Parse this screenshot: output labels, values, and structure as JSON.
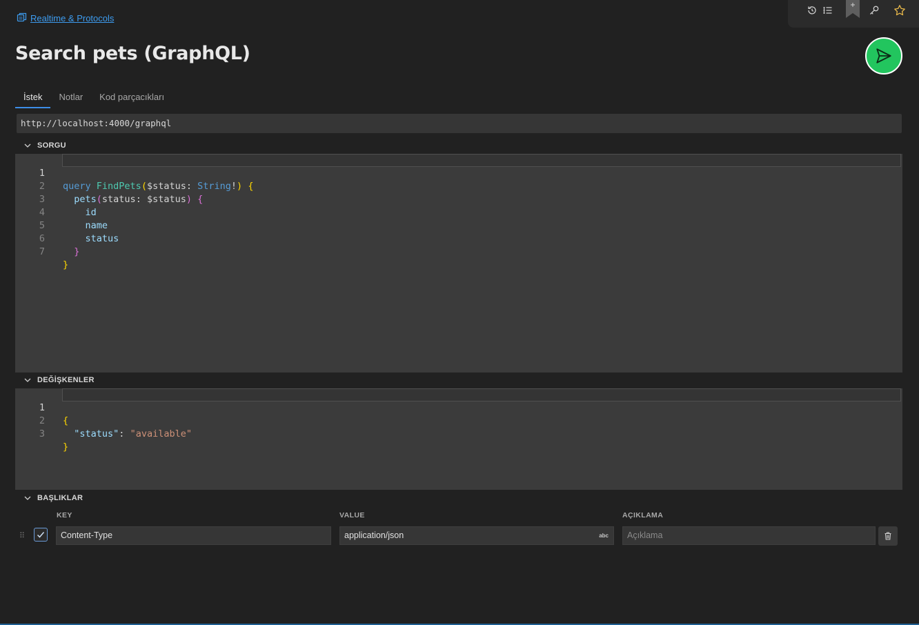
{
  "breadcrumb": {
    "icon": "collection-icon",
    "label": "Realtime & Protocols"
  },
  "toolbar": {
    "icons": [
      "history-icon",
      "list-icon",
      "bookmark-icon",
      "key-icon",
      "star-icon"
    ]
  },
  "title": "Search pets (GraphQL)",
  "send_button": {
    "icon": "send-icon",
    "color": "#22c55e"
  },
  "tabs": [
    {
      "label": "İstek",
      "active": true
    },
    {
      "label": "Notlar",
      "active": false
    },
    {
      "label": "Kod parçacıkları",
      "active": false
    }
  ],
  "url": "http://localhost:4000/graphql",
  "query_section": {
    "title": "SORGU",
    "line_numbers": [
      "1",
      "2",
      "3",
      "4",
      "5",
      "6",
      "7"
    ],
    "lines": [
      "query FindPets($status: String!) {",
      "  pets(status: $status) {",
      "    id",
      "    name",
      "    status",
      "  }",
      "}"
    ]
  },
  "variables_section": {
    "title": "DEĞİŞKENLER",
    "line_numbers": [
      "1",
      "2",
      "3"
    ],
    "lines": [
      "{",
      "  \"status\": \"available\"",
      "}"
    ]
  },
  "headers_section": {
    "title": "BAŞLIKLAR",
    "columns": {
      "key": "KEY",
      "value": "VALUE",
      "description": "AÇIKLAMA"
    },
    "rows": [
      {
        "checked": true,
        "key": "Content-Type",
        "value": "application/json",
        "value_badge": "abc",
        "description_placeholder": "Açıklama"
      }
    ]
  },
  "colors": {
    "accent": "#3d9cf0",
    "background": "#212121",
    "editor": "#3b3b3b"
  }
}
